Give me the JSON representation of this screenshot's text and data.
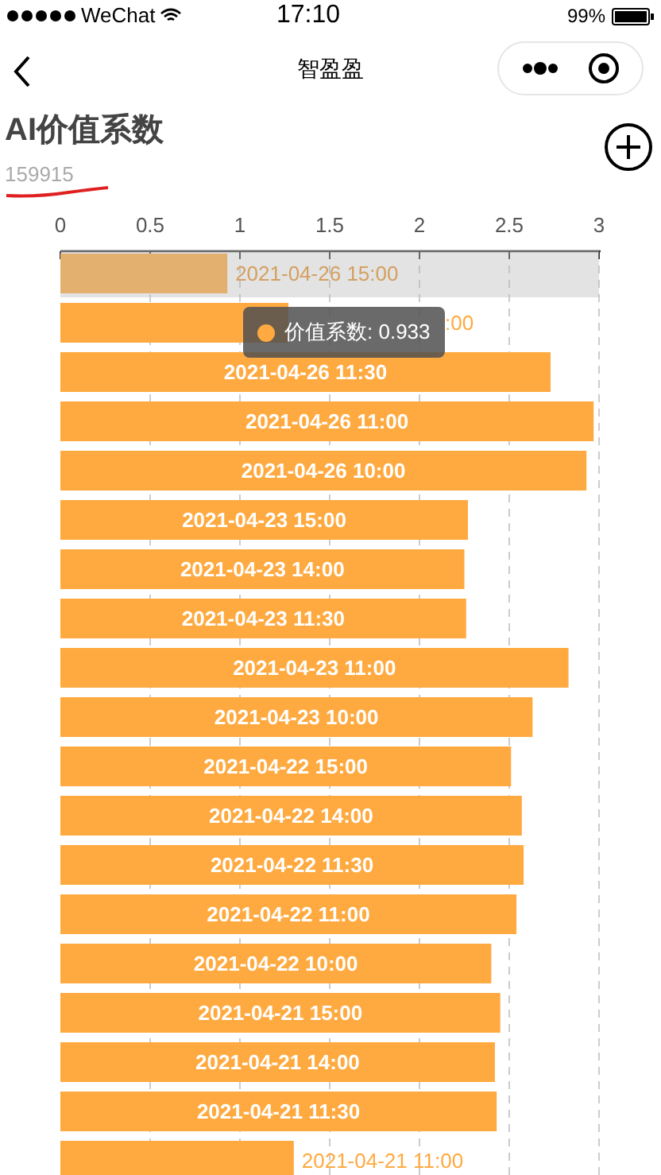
{
  "status_bar": {
    "carrier": "WeChat",
    "time": "17:10",
    "battery": "99%"
  },
  "nav_bar": {
    "title": "智盈盈"
  },
  "header": {
    "title": "AI价值系数",
    "code": "159915"
  },
  "chart": {
    "chart_data": {
      "type": "bar",
      "orientation": "horizontal",
      "categories": [
        "2021-04-26 15:00",
        ":00",
        "2021-04-26 11:30",
        "2021-04-26 11:00",
        "2021-04-26 10:00",
        "2021-04-23 15:00",
        "2021-04-23 14:00",
        "2021-04-23 11:30",
        "2021-04-23 11:00",
        "2021-04-23 10:00",
        "2021-04-22 15:00",
        "2021-04-22 14:00",
        "2021-04-22 11:30",
        "2021-04-22 11:00",
        "2021-04-22 10:00",
        "2021-04-21 15:00",
        "2021-04-21 14:00",
        "2021-04-21 11:30",
        "2021-04-21 11:00"
      ],
      "series": [
        {
          "color": "#ffaa40",
          "values": [
            0.93,
            1.27,
            2.73,
            2.97,
            2.93,
            2.27,
            2.25,
            2.26,
            2.83,
            2.63,
            2.51,
            2.57,
            2.58,
            2.54,
            2.4,
            2.45,
            2.42,
            2.43,
            1.3
          ]
        }
      ],
      "xlim": [
        0,
        3
      ],
      "grid": true,
      "xticks": [
        0,
        0.5,
        1,
        1.5,
        2,
        2.5,
        3
      ]
    },
    "bar_states": [
      {
        "highlighted": true
      },
      {
        "highlighted": false
      },
      {
        "highlighted": false
      },
      {
        "highlighted": false
      },
      {
        "highlighted": false
      },
      {
        "highlighted": false
      },
      {
        "highlighted": false
      },
      {
        "highlighted": false
      },
      {
        "highlighted": false
      },
      {
        "highlighted": false
      },
      {
        "highlighted": false
      },
      {
        "highlighted": false
      },
      {
        "highlighted": false
      },
      {
        "highlighted": false
      },
      {
        "highlighted": false
      },
      {
        "highlighted": false
      },
      {
        "highlighted": false
      },
      {
        "highlighted": false
      },
      {
        "highlighted": false
      }
    ],
    "tooltip": {
      "text": "价值系数: 0.933",
      "color": "#ffaa40"
    }
  }
}
